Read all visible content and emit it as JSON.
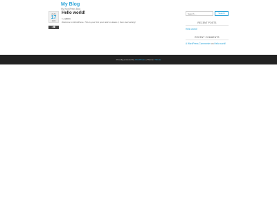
{
  "header": {
    "site_title": "My Blog",
    "site_description": "My WordPress Blog"
  },
  "post": {
    "date": {
      "month": "AUG",
      "day": "17",
      "year": "2023"
    },
    "comment_count": "1",
    "title": "Hello world!",
    "meta_by": "by",
    "author": "admin",
    "excerpt": "Welcome to WordPress. This is your first post. Edit or delete it, then start writing!"
  },
  "sidebar": {
    "search": {
      "placeholder": "Search ...",
      "button_label": "Search"
    },
    "recent_posts": {
      "title": "RECENT POSTS",
      "items": [
        "Hello world!"
      ]
    },
    "recent_comments": {
      "title": "RECENT COMMENTS",
      "items": [
        {
          "author": "A WordPress Commenter",
          "connector": "on",
          "post": "Hello world!"
        }
      ]
    }
  },
  "footer": {
    "prefix": "Proudly powered by",
    "wordpress_link": "WordPress",
    "separator": " | Theme: ",
    "theme_link": "Tribute"
  },
  "colors": {
    "accent": "#2aa3d8",
    "footer_bg": "#222222",
    "comment_badge_bg": "#444444"
  },
  "icons": {
    "comment": "speech-bubble"
  }
}
